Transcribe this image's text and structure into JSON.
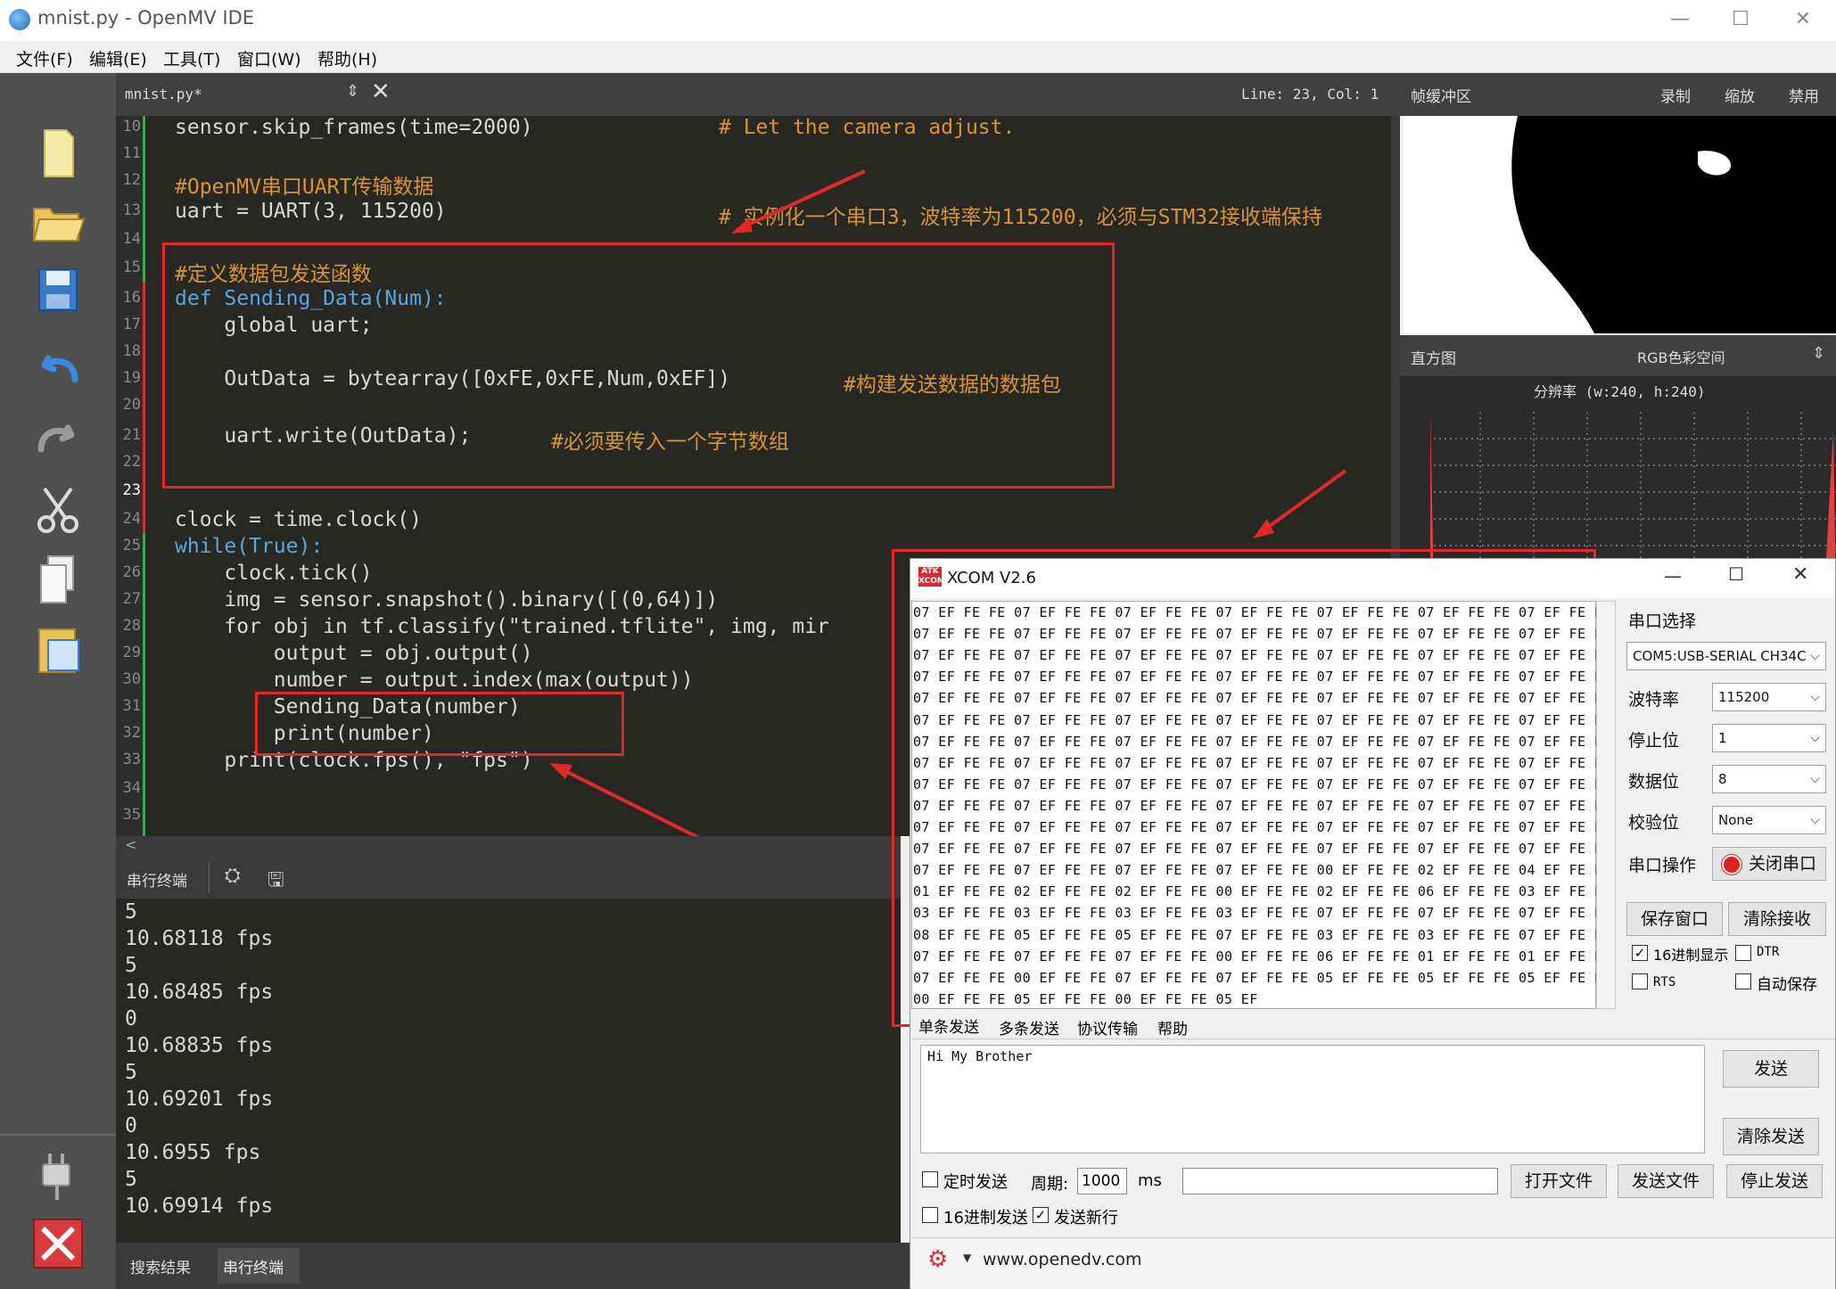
{
  "window": {
    "title": "mnist.py - OpenMV IDE"
  },
  "menu": [
    "文件(F)",
    "编辑(E)",
    "工具(T)",
    "窗口(W)",
    "帮助(H)"
  ],
  "editor": {
    "tab_name": "mnist.py*",
    "position": "Line: 23, Col: 1",
    "line_numbers": [
      "10",
      "11",
      "12",
      "13",
      "14",
      "15",
      "16",
      "17",
      "18",
      "19",
      "20",
      "21",
      "22",
      "23",
      "24",
      "25",
      "26",
      "27",
      "28",
      "29",
      "30",
      "31",
      "32",
      "33",
      "34",
      "35"
    ],
    "code": {
      "l10": "sensor.skip_frames(time=2000)",
      "l10c": "# Let the camera adjust.",
      "l12": "#OpenMV串口UART传输数据",
      "l13": "uart = UART(3, 115200)",
      "l13c": "# 实例化一个串口3，波特率为115200，必须与STM32接收端保持",
      "l15": "#定义数据包发送函数",
      "l16": "def Sending_Data(Num):",
      "l17": "    global uart;",
      "l19": "    OutData = bytearray([0xFE,0xFE,Num,0xEF])",
      "l19c": "#构建发送数据的数据包",
      "l21": "    uart.write(OutData);",
      "l21c": "#必须要传入一个字节数组",
      "l24": "clock = time.clock()",
      "l25": "while(True):",
      "l26": "    clock.tick()",
      "l27": "    img = sensor.snapshot().binary([(0,64)])",
      "l28": "    for obj in tf.classify(\"trained.tflite\", img, mir",
      "l29": "        output = obj.output()",
      "l30": "        number = output.index(max(output))",
      "l31": "        Sending_Data(number)",
      "l32": "        print(number)",
      "l33": "    print(clock.fps(), \"fps\")"
    }
  },
  "terminal": {
    "title": "串行终端",
    "lines": [
      "5",
      "10.68118 fps",
      "5",
      "10.68485 fps",
      "0",
      "10.68835 fps",
      "5",
      "10.69201 fps",
      "0",
      "10.6955 fps",
      "5",
      "10.69914 fps"
    ]
  },
  "bottom_tabs": [
    "搜索结果",
    "串行终端"
  ],
  "frame_buffer": {
    "title": "帧缓冲区",
    "record": "录制",
    "zoom": "缩放",
    "disable": "禁用"
  },
  "histogram": {
    "title": "直方图",
    "color_space": "RGB色彩空间",
    "resolution": "分辨率 (w:240, h:240)"
  },
  "xcom": {
    "title": "XCOM V2.6",
    "rows": [
      "07 EF FE FE 07 EF FE FE 07 EF FE FE 07 EF FE FE 07 EF FE FE 07 EF FE FE 07 EF FE FE",
      "07 EF FE FE 07 EF FE FE 07 EF FE FE 07 EF FE FE 07 EF FE FE 07 EF FE FE 07 EF FE FE",
      "07 EF FE FE 07 EF FE FE 07 EF FE FE 07 EF FE FE 07 EF FE FE 07 EF FE FE 07 EF FE FE",
      "07 EF FE FE 07 EF FE FE 07 EF FE FE 07 EF FE FE 07 EF FE FE 07 EF FE FE 07 EF FE FE",
      "07 EF FE FE 07 EF FE FE 07 EF FE FE 07 EF FE FE 07 EF FE FE 07 EF FE FE 07 EF FE FE",
      "07 EF FE FE 07 EF FE FE 07 EF FE FE 07 EF FE FE 07 EF FE FE 07 EF FE FE 07 EF FE FE",
      "07 EF FE FE 07 EF FE FE 07 EF FE FE 07 EF FE FE 07 EF FE FE 07 EF FE FE 07 EF FE FE",
      "07 EF FE FE 07 EF FE FE 07 EF FE FE 07 EF FE FE 07 EF FE FE 07 EF FE FE 07 EF FE FE",
      "07 EF FE FE 07 EF FE FE 07 EF FE FE 07 EF FE FE 07 EF FE FE 07 EF FE FE 07 EF FE FE",
      "07 EF FE FE 07 EF FE FE 07 EF FE FE 07 EF FE FE 07 EF FE FE 07 EF FE FE 07 EF FE FE",
      "07 EF FE FE 07 EF FE FE 07 EF FE FE 07 EF FE FE 07 EF FE FE 07 EF FE FE 07 EF FE FE",
      "07 EF FE FE 07 EF FE FE 07 EF FE FE 07 EF FE FE 07 EF FE FE 07 EF FE FE 07 EF FE FE",
      "07 EF FE FE 07 EF FE FE 07 EF FE FE 07 EF FE FE 00 EF FE FE 02 EF FE FE 04 EF FE FE",
      "01 EF FE FE 02 EF FE FE 02 EF FE FE 00 EF FE FE 02 EF FE FE 06 EF FE FE 03 EF FE FE",
      "03 EF FE FE 03 EF FE FE 03 EF FE FE 03 EF FE FE 07 EF FE FE 07 EF FE FE 07 EF FE FE",
      "08 EF FE FE 05 EF FE FE 05 EF FE FE 07 EF FE FE 03 EF FE FE 03 EF FE FE 07 EF FE FE",
      "07 EF FE FE 07 EF FE FE 07 EF FE FE 00 EF FE FE 06 EF FE FE 01 EF FE FE 01 EF FE FE",
      "07 EF FE FE 00 EF FE FE 07 EF FE FE 07 EF FE FE 05 EF FE FE 05 EF FE FE 05 EF FE FE",
      "00 EF FE FE 05 EF FE FE 00 EF FE FE 05 EF"
    ],
    "port_select": "串口选择",
    "port": "COM5:USB-SERIAL CH34C",
    "baud_label": "波特率",
    "baud": "115200",
    "stop_label": "停止位",
    "stop": "1",
    "data_label": "数据位",
    "databits": "8",
    "parity_label": "校验位",
    "parity": "None",
    "op_label": "串口操作",
    "close_port": "关闭串口",
    "save_window": "保存窗口",
    "clear_recv": "清除接收",
    "hex_display": "16进制显示",
    "dtr": "DTR",
    "rts": "RTS",
    "auto_save": "自动保存",
    "tabs": [
      "单条发送",
      "多条发送",
      "协议传输",
      "帮助"
    ],
    "send_text": "Hi My Brother",
    "send": "发送",
    "clear_send": "清除发送",
    "timed_send": "定时发送",
    "period_label": "周期:",
    "period": "1000",
    "ms": "ms",
    "open_file": "打开文件",
    "send_file": "发送文件",
    "stop_send": "停止发送",
    "hex_send": "16进制发送",
    "send_newline": "发送新行",
    "status_url": "www.openedv.com"
  }
}
